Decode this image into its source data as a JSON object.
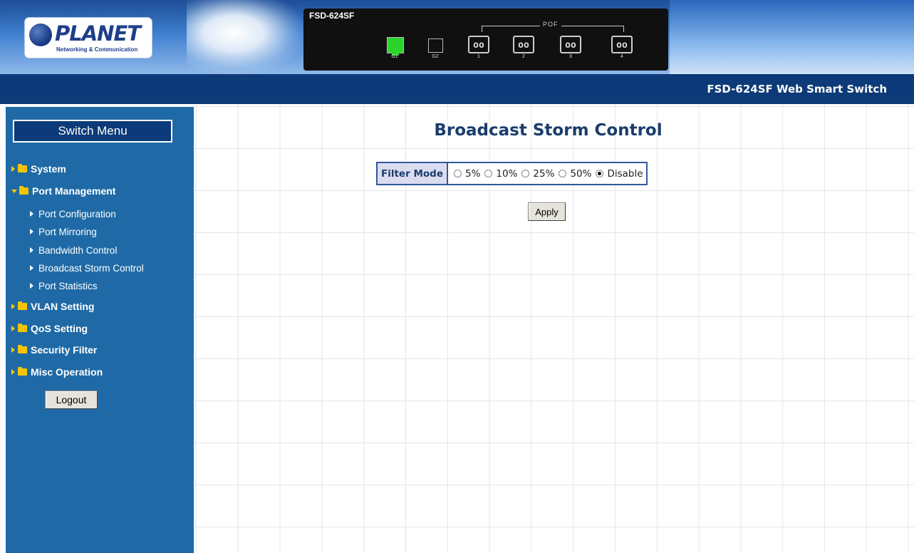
{
  "header": {
    "logo": {
      "brand": "PLANET",
      "tagline": "Networking & Communication"
    },
    "device": {
      "model": "FSD-624SF",
      "pof_group_label": "POF",
      "ports": [
        {
          "label": "G1",
          "status": "link-up"
        },
        {
          "label": "G2",
          "status": "link-down"
        },
        {
          "label": "1",
          "glyph": "oo"
        },
        {
          "label": "2",
          "glyph": "oo"
        },
        {
          "label": "3",
          "glyph": "oo"
        },
        {
          "label": "4",
          "glyph": "oo"
        }
      ]
    }
  },
  "titlebar": {
    "title": "FSD-624SF Web Smart Switch"
  },
  "sidebar": {
    "menu_title": "Switch Menu",
    "items": [
      {
        "label": "System",
        "expanded": false
      },
      {
        "label": "Port Management",
        "expanded": true,
        "children": [
          {
            "label": "Port Configuration"
          },
          {
            "label": "Port Mirroring"
          },
          {
            "label": "Bandwidth Control"
          },
          {
            "label": "Broadcast Storm Control"
          },
          {
            "label": "Port Statistics"
          }
        ]
      },
      {
        "label": "VLAN Setting",
        "expanded": false
      },
      {
        "label": "QoS Setting",
        "expanded": false
      },
      {
        "label": "Security Filter",
        "expanded": false
      },
      {
        "label": "Misc Operation",
        "expanded": false
      }
    ],
    "logout_label": "Logout"
  },
  "main": {
    "title": "Broadcast Storm Control",
    "filter_mode": {
      "label": "Filter Mode",
      "options": [
        "5%",
        "10%",
        "25%",
        "50%",
        "Disable"
      ],
      "selected": "Disable"
    },
    "apply_label": "Apply"
  },
  "colors": {
    "titlebar": "#0d3a78",
    "sidebar": "#1f6aa6",
    "heading": "#1a3d6b",
    "folder": "#f4c400",
    "link_up": "#2cd32c"
  }
}
